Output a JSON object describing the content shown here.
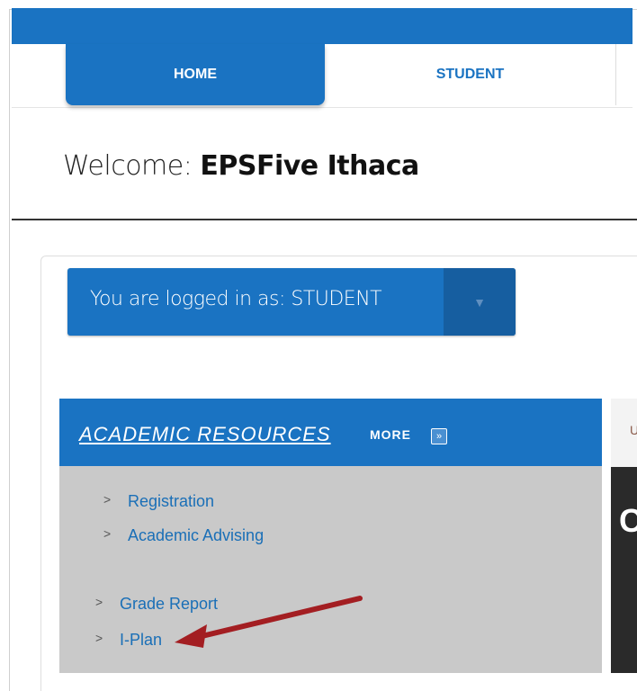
{
  "tabs": [
    {
      "label": "HOME"
    },
    {
      "label": "STUDENT"
    }
  ],
  "welcome": {
    "prefix": "Welcome: ",
    "name": "EPSFive Ithaca"
  },
  "login": {
    "text": "You are logged in as:  STUDENT",
    "dropdown_icon": "triangle-down-icon"
  },
  "academic_resources": {
    "title": "ACADEMIC RESOURCES",
    "more_label": "MORE",
    "more_icon": "double-chevron-right-icon",
    "links": [
      {
        "label": "Registration"
      },
      {
        "label": "Academic Advising"
      },
      {
        "label": "Grade Report"
      },
      {
        "label": "I-Plan"
      }
    ]
  },
  "right_panel": {
    "letter": "C",
    "small_letter": "U"
  },
  "colors": {
    "accent": "#1a73c2",
    "arrow": "#a31e22",
    "link": "#1a6fb7"
  }
}
